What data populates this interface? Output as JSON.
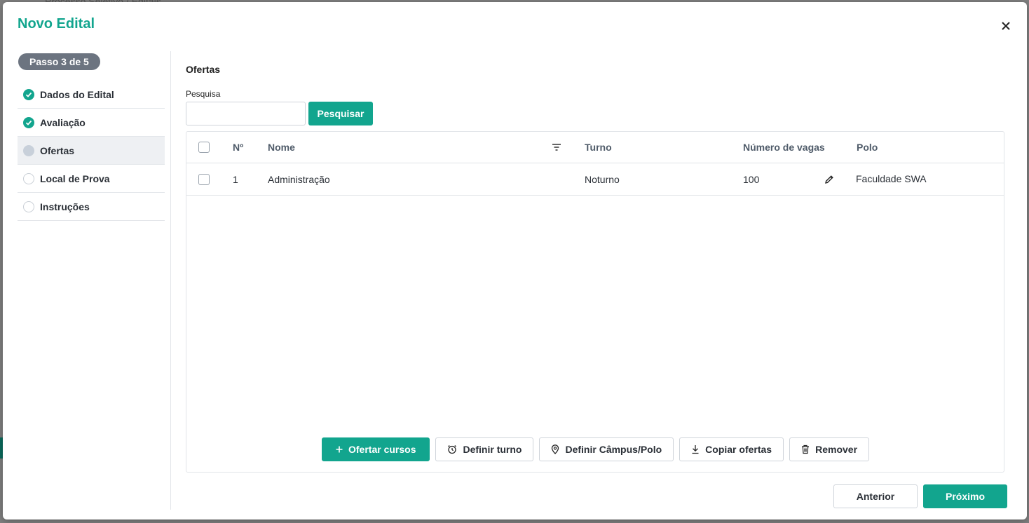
{
  "background": {
    "breadcrumb": "Processo Seletivo / Editais"
  },
  "modal": {
    "title": "Novo Edital",
    "close_icon": "close-icon"
  },
  "stepper": {
    "badge": "Passo 3 de 5",
    "steps": [
      {
        "label": "Dados do Edital",
        "status": "done"
      },
      {
        "label": "Avaliação",
        "status": "done"
      },
      {
        "label": "Ofertas",
        "status": "current"
      },
      {
        "label": "Local de Prova",
        "status": "todo"
      },
      {
        "label": "Instruções",
        "status": "todo"
      }
    ]
  },
  "ofertas": {
    "title": "Ofertas",
    "search_label": "Pesquisa",
    "search_value": "",
    "search_button": "Pesquisar",
    "columns": {
      "num": "Nº",
      "nome": "Nome",
      "turno": "Turno",
      "vagas": "Número de vagas",
      "polo": "Polo"
    },
    "rows": [
      {
        "num": "1",
        "nome": "Administração",
        "turno": "Noturno",
        "vagas": "100",
        "polo": "Faculdade SWA",
        "selected": false
      }
    ],
    "actions": {
      "ofertar": "Ofertar cursos",
      "turno": "Definir turno",
      "polo": "Definir Câmpus/Polo",
      "copiar": "Copiar ofertas",
      "remover": "Remover"
    }
  },
  "footer": {
    "prev": "Anterior",
    "next": "Próximo"
  },
  "colors": {
    "accent": "#12a58e",
    "badge": "#6c7480"
  }
}
